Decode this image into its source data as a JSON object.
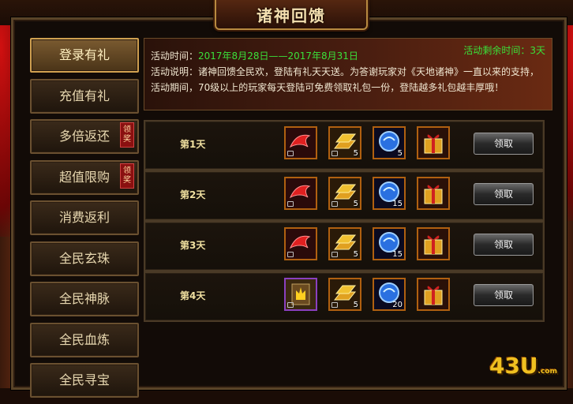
{
  "window": {
    "title": "诸神回馈"
  },
  "sidebar": {
    "items": [
      {
        "label": "登录有礼",
        "active": true
      },
      {
        "label": "充值有礼"
      },
      {
        "label": "多倍返还",
        "badge": "领奖"
      },
      {
        "label": "超值限购",
        "badge": "领奖"
      },
      {
        "label": "消费返利"
      },
      {
        "label": "全民玄珠"
      },
      {
        "label": "全民神脉"
      },
      {
        "label": "全民血炼"
      },
      {
        "label": "全民寻宝"
      }
    ]
  },
  "info": {
    "time_label": "活动时间：",
    "time_value": "2017年8月28日——2017年8月31日",
    "remain": "活动剩余时间：3天",
    "desc": "活动说明：诸神回馈全民欢，登陆有礼天天送。为答谢玩家对《天地诸神》一直以来的支持，活动期间，70级以上的玩家每天登陆可免费领取礼包一份，登陆越多礼包越丰厚哦！"
  },
  "rewards": [
    {
      "day": "第1天",
      "items": [
        {
          "icon": "red-ribbon-icon",
          "count": ""
        },
        {
          "icon": "gold-bars-icon",
          "count": "5"
        },
        {
          "icon": "blue-orb-icon",
          "count": "5"
        },
        {
          "icon": "gift-box-icon",
          "count": ""
        }
      ],
      "button": "领取"
    },
    {
      "day": "第2天",
      "items": [
        {
          "icon": "red-ribbon-icon",
          "count": ""
        },
        {
          "icon": "gold-bars-icon",
          "count": "5"
        },
        {
          "icon": "blue-orb-icon",
          "count": "15"
        },
        {
          "icon": "gift-box-icon",
          "count": ""
        }
      ],
      "button": "领取"
    },
    {
      "day": "第3天",
      "items": [
        {
          "icon": "red-ribbon-icon",
          "count": ""
        },
        {
          "icon": "gold-bars-icon",
          "count": "5"
        },
        {
          "icon": "blue-orb-icon",
          "count": "15"
        },
        {
          "icon": "gift-box-icon",
          "count": ""
        }
      ],
      "button": "领取"
    },
    {
      "day": "第4天",
      "items": [
        {
          "icon": "golden-scroll-icon",
          "count": ""
        },
        {
          "icon": "gold-bars-icon",
          "count": "5"
        },
        {
          "icon": "blue-orb-icon",
          "count": "20"
        },
        {
          "icon": "gift-box-icon",
          "count": ""
        }
      ],
      "button": "领取"
    }
  ],
  "logo": {
    "text": "43U",
    "sub": ".com"
  },
  "colors": {
    "accent_green": "#3ae03a",
    "frame": "#5a4428",
    "item_border": "#b06010"
  }
}
